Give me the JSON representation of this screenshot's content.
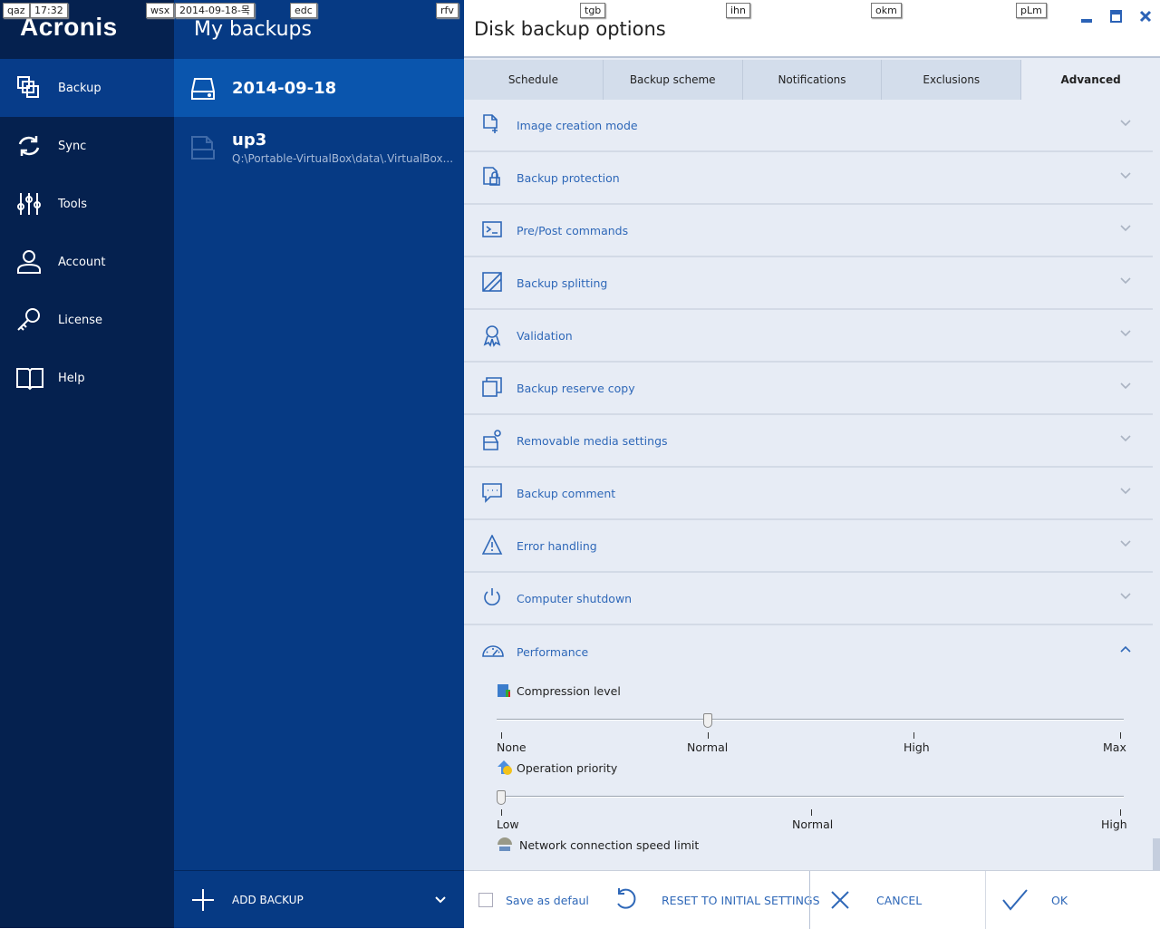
{
  "app": {
    "logo": "Acronis"
  },
  "nav": {
    "items": [
      {
        "label": "Backup",
        "icon": "backup-icon"
      },
      {
        "label": "Sync",
        "icon": "sync-icon"
      },
      {
        "label": "Tools",
        "icon": "tools-icon"
      },
      {
        "label": "Account",
        "icon": "account-icon"
      },
      {
        "label": "License",
        "icon": "key-icon"
      },
      {
        "label": "Help",
        "icon": "book-icon"
      }
    ],
    "selected": "Backup"
  },
  "backups": {
    "title": "My backups",
    "items": [
      {
        "name": "2014-09-18",
        "path": ""
      },
      {
        "name": "up3",
        "path": "Q:\\Portable-VirtualBox\\data\\.VirtualBox..."
      }
    ],
    "add_label": "ADD BACKUP"
  },
  "dialog": {
    "title": "Disk backup options",
    "tabs": [
      "Schedule",
      "Backup scheme",
      "Notifications",
      "Exclusions",
      "Advanced"
    ],
    "active_tab": "Advanced",
    "sections": [
      "Image creation mode",
      "Backup protection",
      "Pre/Post commands",
      "Backup splitting",
      "Validation",
      "Backup reserve copy",
      "Removable media settings",
      "Backup comment",
      "Error handling",
      "Computer shutdown",
      "Performance"
    ],
    "performance": {
      "compression": {
        "label": "Compression level",
        "ticks": [
          "None",
          "Normal",
          "High",
          "Max"
        ],
        "value": "Normal"
      },
      "priority": {
        "label": "Operation priority",
        "ticks": [
          "Low",
          "Normal",
          "High"
        ],
        "value": "Low"
      },
      "network": {
        "label": "Network connection speed limit"
      }
    },
    "footer": {
      "save_default": "Save as defaul",
      "save_default_checked": false,
      "reset": "RESET TO INITIAL SETTINGS",
      "cancel": "CANCEL",
      "ok": "OK"
    }
  },
  "key_hints": [
    "qaz",
    "17:32",
    "wsx",
    "2014-09-18-목",
    "edc",
    "rfv",
    "tgb",
    "ihn",
    "okm",
    "pLm"
  ],
  "colors": {
    "nav_bg": "#05214f",
    "list_bg": "#063a84",
    "selected": "#0a55ad",
    "accent": "#2f68b8"
  }
}
